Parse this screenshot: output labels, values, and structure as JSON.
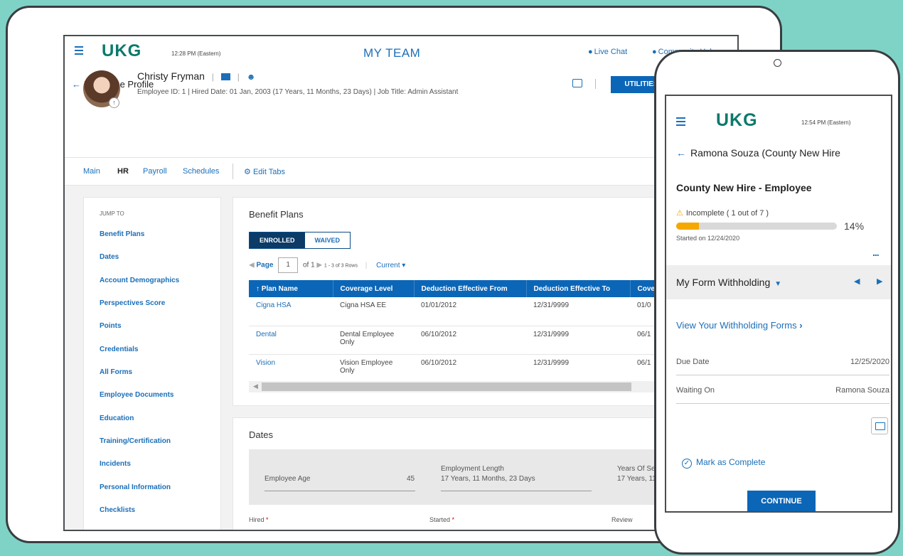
{
  "desktop": {
    "logo": "UKG",
    "time": "12:28 PM (Eastern)",
    "page_title": "MY TEAM",
    "links": [
      "Live Chat",
      "Community Help"
    ],
    "back_label": "Employee Profile",
    "utilities_label": "UTILITIES",
    "employee": {
      "name": "Christy Fryman",
      "meta": "Employee ID: 1  |  Hired Date: 01 Jan, 2003 (17 Years, 11 Months, 23 Days)  |  Job Title: Admin Assistant"
    },
    "tabs": [
      "Main",
      "HR",
      "Payroll",
      "Schedules"
    ],
    "active_tab": "HR",
    "edit_tabs_label": "Edit Tabs",
    "jump_to": {
      "header": "JUMP TO",
      "items": [
        "Benefit Plans",
        "Dates",
        "Account Demographics",
        "Perspectives Score",
        "Points",
        "Credentials",
        "All Forms",
        "Employee Documents",
        "Education",
        "Training/Certification",
        "Incidents",
        "Personal Information",
        "Checklists"
      ]
    },
    "benefit_plans": {
      "title": "Benefit Plans",
      "seg_enrolled": "ENROLLED",
      "seg_waived": "WAIVED",
      "pager": {
        "page_label": "Page",
        "page": "1",
        "of": "of 1",
        "rows": "1 - 3 of 3 Rows",
        "filter": "Current"
      },
      "columns": [
        "Plan Name",
        "Coverage Level",
        "Deduction Effective From",
        "Deduction Effective To",
        "Cove"
      ],
      "rows": [
        {
          "plan": "Cigna HSA",
          "coverage": "Cigna HSA EE",
          "from": "01/01/2012",
          "to": "12/31/9999",
          "cove": "01/0"
        },
        {
          "plan": "Dental",
          "coverage": "Dental Employee Only",
          "from": "06/10/2012",
          "to": "12/31/9999",
          "cove": "06/1"
        },
        {
          "plan": "Vision",
          "coverage": "Vision Employee Only",
          "from": "06/10/2012",
          "to": "12/31/9999",
          "cove": "06/1"
        }
      ]
    },
    "dates": {
      "title": "Dates",
      "employee_age_label": "Employee Age",
      "employee_age": "45",
      "employment_length_label": "Employment Length",
      "employment_length": "17 Years, 11 Months, 23 Days",
      "years_of_service_label": "Years Of Servic",
      "years_of_service": "17 Years, 11 M",
      "hired_label": "Hired",
      "started_label": "Started",
      "review_label": "Review"
    }
  },
  "mobile": {
    "logo": "UKG",
    "time": "12:54 PM (Eastern)",
    "back_label": "Ramona Souza (County New Hire",
    "title": "County New Hire - Employee",
    "status": "Incomplete ( 1 out of 7 )",
    "progress": 0.14,
    "progress_label": "14%",
    "started": "Started on 12/24/2020",
    "more": "...",
    "section": "My Form Withholding",
    "view_link": "View Your Withholding Forms",
    "due_date_label": "Due Date",
    "due_date": "12/25/2020",
    "waiting_on_label": "Waiting On",
    "waiting_on": "Ramona Souza",
    "mark_complete": "Mark as Complete",
    "continue_label": "CONTINUE"
  },
  "colors": {
    "background": "#7fd3c6",
    "primary": "#0b66b7",
    "brand": "#0a7a6b",
    "warning": "#f5a800"
  }
}
